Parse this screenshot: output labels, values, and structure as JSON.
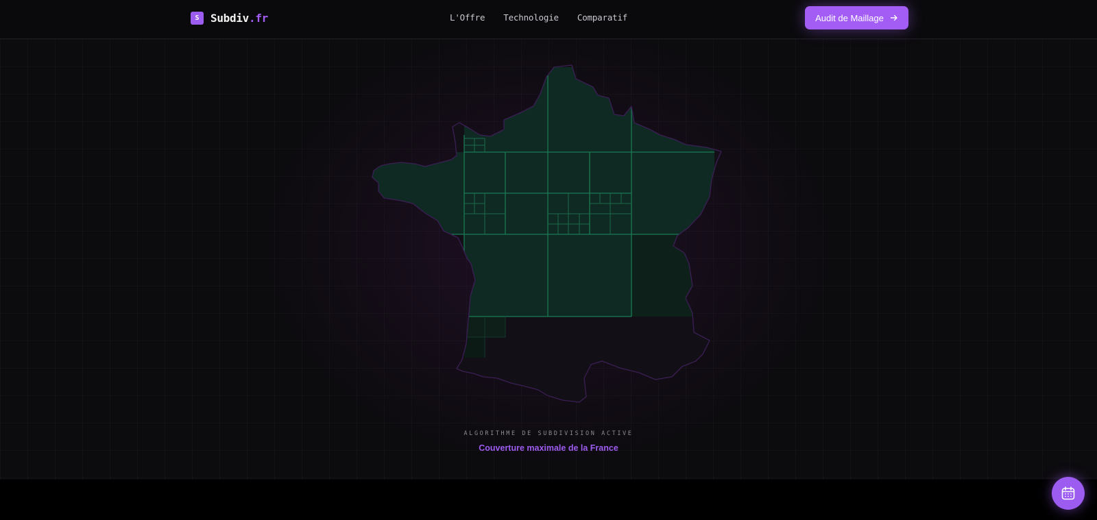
{
  "header": {
    "logo_badge": "S",
    "logo_name": "Subdiv",
    "logo_tld": ".fr",
    "nav": [
      "L'Offre",
      "Technologie",
      "Comparatif"
    ],
    "cta_label": "Audit de Maillage",
    "cta_icon": "arrow-right-icon"
  },
  "hero": {
    "map_icon": "france-map-icon",
    "caption": "ALGORITHME DE SUBDIVISION ACTIVE",
    "subcaption": "Couverture maximale de la France"
  },
  "fab": {
    "icon": "calendar-icon"
  },
  "colors": {
    "accent": "#a35df5",
    "mesh_fill": "#0f2a22",
    "mesh_line": "#1a7a55",
    "map_outline": "#3b1f55",
    "background": "#0c0b0e"
  }
}
